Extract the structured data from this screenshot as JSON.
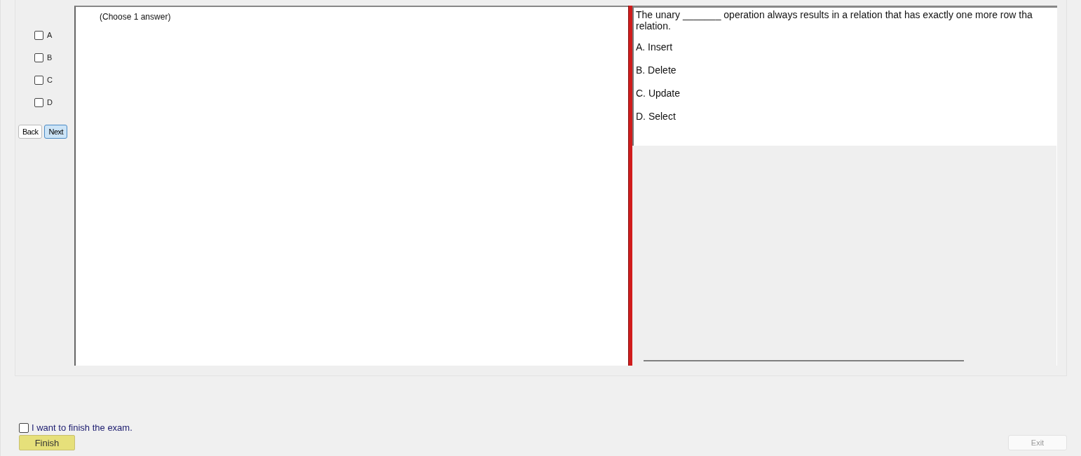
{
  "answer_options": [
    {
      "label": "A",
      "checked": false
    },
    {
      "label": "B",
      "checked": false
    },
    {
      "label": "C",
      "checked": false
    },
    {
      "label": "D",
      "checked": false
    }
  ],
  "nav_buttons": [
    {
      "label": "Back",
      "selected": false
    },
    {
      "label": "Next",
      "selected": true
    }
  ],
  "answer_pane": {
    "instruction": "(Choose 1 answer)"
  },
  "question": {
    "lines": [
      "The unary _______ operation always results in a relation that has exactly one more row tha",
      "relation."
    ],
    "choices": [
      "A.  Insert",
      "B.  Delete",
      "C.  Update",
      "D.  Select"
    ]
  },
  "finish": {
    "label": "I want to finish the exam.",
    "checked": false,
    "button": "Finish"
  },
  "exit_button": {
    "label": "Exit",
    "disabled": true
  }
}
